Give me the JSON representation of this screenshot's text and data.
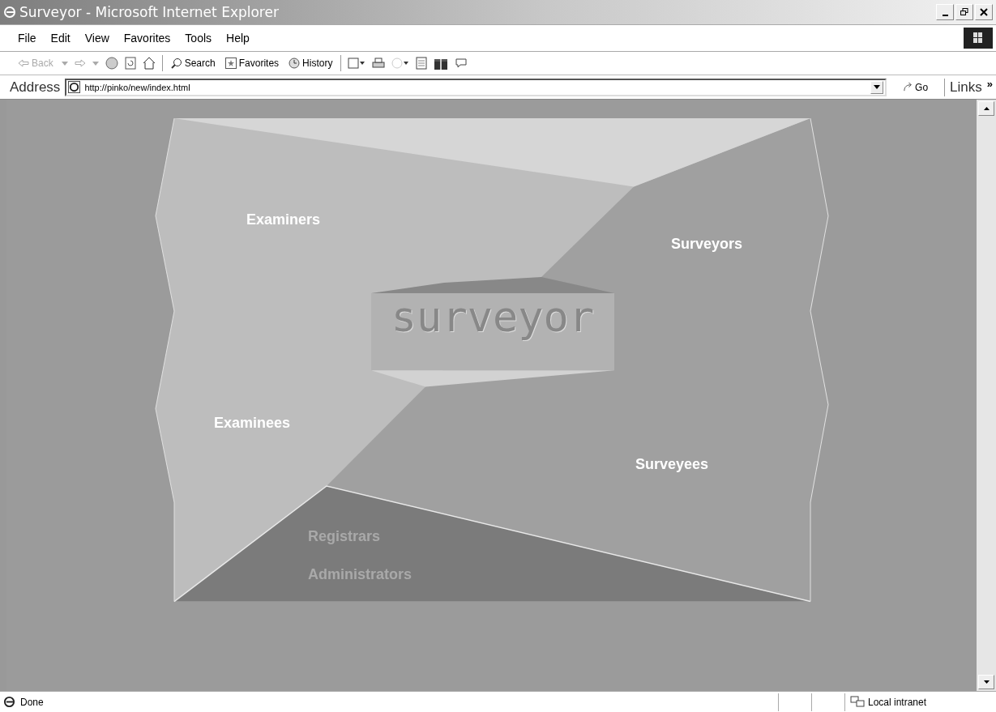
{
  "window": {
    "title": "Surveyor - Microsoft Internet Explorer"
  },
  "menu": [
    {
      "label": "File"
    },
    {
      "label": "Edit"
    },
    {
      "label": "View"
    },
    {
      "label": "Favorites"
    },
    {
      "label": "Tools"
    },
    {
      "label": "Help"
    }
  ],
  "toolbar": {
    "back": {
      "label": "Back",
      "disabled": true
    },
    "search": {
      "label": "Search"
    },
    "favorites": {
      "label": "Favorites"
    },
    "history": {
      "label": "History"
    }
  },
  "address_bar": {
    "label": "Address",
    "url": "http://pinko/new/index.html",
    "go": "Go",
    "links": "Links",
    "more": "»"
  },
  "page": {
    "logo": "surveyor",
    "links": [
      {
        "label": "Examiners",
        "disabled": false
      },
      {
        "label": "Surveyors",
        "disabled": false
      },
      {
        "label": "Examinees",
        "disabled": false
      },
      {
        "label": "Surveyees",
        "disabled": false
      },
      {
        "label": "Registrars",
        "disabled": true
      },
      {
        "label": "Administrators",
        "disabled": true
      }
    ]
  },
  "status_bar": {
    "text": "Done",
    "zone": "Local intranet"
  }
}
